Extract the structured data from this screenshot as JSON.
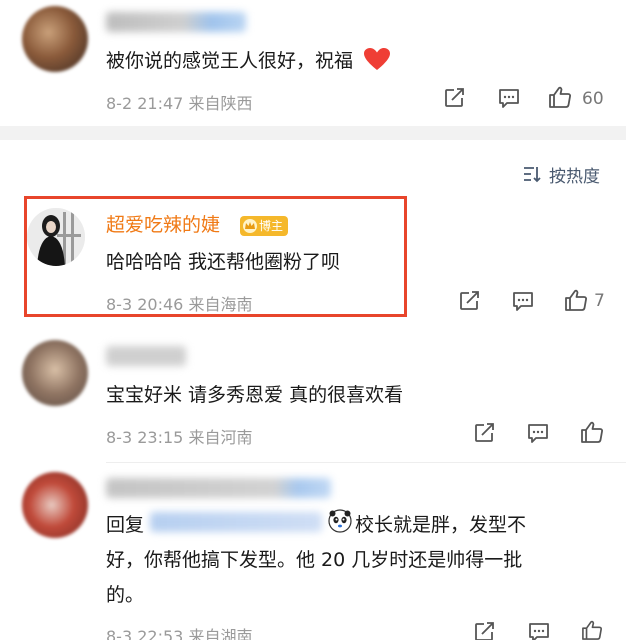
{
  "sort": {
    "label": "按热度"
  },
  "comments": [
    {
      "user": "",
      "text": "被你说的感觉王人很好，祝福",
      "emoji": "heart",
      "date": "8-2",
      "time": "21:47",
      "location": "来自陕西",
      "likes": "60"
    },
    {
      "user": "超爱吃辣的婕",
      "badge": "博主",
      "text": "哈哈哈哈 我还帮他圈粉了呗",
      "date": "8-3",
      "time": "20:46",
      "location": "来自海南",
      "likes": "7"
    },
    {
      "user": "",
      "text": "宝宝好米 请多秀恩爱 真的很喜欢看",
      "date": "8-3",
      "time": "23:15",
      "location": "来自河南",
      "likes": ""
    },
    {
      "user": "",
      "reply_prefix": "回复",
      "text_line1": "校长就是胖，发型不",
      "text_line2": "好，你帮他搞下发型。他 20 几岁时还是帅得一批",
      "text_line3": "的。",
      "date": "8-3",
      "time": "22:53",
      "location": "来自湖南",
      "likes": ""
    }
  ],
  "colors": {
    "highlight": "#e8452b",
    "name": "#f07a16",
    "badge": "#f5b82b"
  },
  "icons": [
    "share-icon",
    "comment-icon",
    "like-icon",
    "heart-emoji",
    "crown-icon",
    "sort-icon",
    "panda-emoji"
  ]
}
